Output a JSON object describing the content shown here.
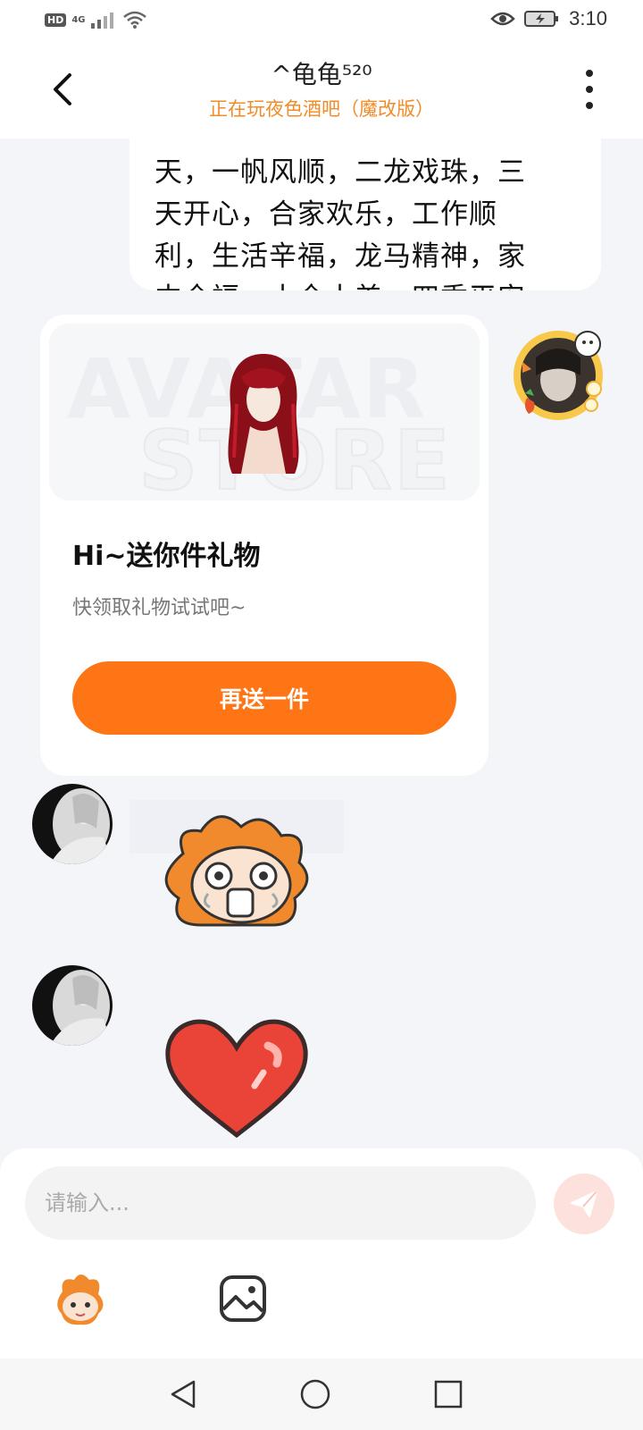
{
  "status_bar": {
    "hd_badge": "HD",
    "network": "4G",
    "time": "3:10"
  },
  "header": {
    "title": "^龟龟⁵²⁰",
    "subtitle": "正在玩夜色酒吧（魔改版）"
  },
  "messages": {
    "text_bubble": {
      "line_partial": "天，一帆风顺，二龙戏珠，三",
      "lines": [
        "天开心，合家欢乐，工作顺",
        "利，生活辛福，龙马精神，家",
        "中全福，十全十美，四季平安"
      ]
    },
    "gift_card": {
      "watermark_line1": "AVATAR",
      "watermark_line2": "STORE",
      "title": "Hi~送你件礼物",
      "subtitle": "快领取礼物试试吧~",
      "button_label": "再送一件"
    }
  },
  "input": {
    "placeholder": "请输入..."
  },
  "colors": {
    "accent": "#fd7514",
    "subtitle": "#f28c28",
    "background": "#f3f5f8",
    "send_button": "#fde1dc"
  }
}
